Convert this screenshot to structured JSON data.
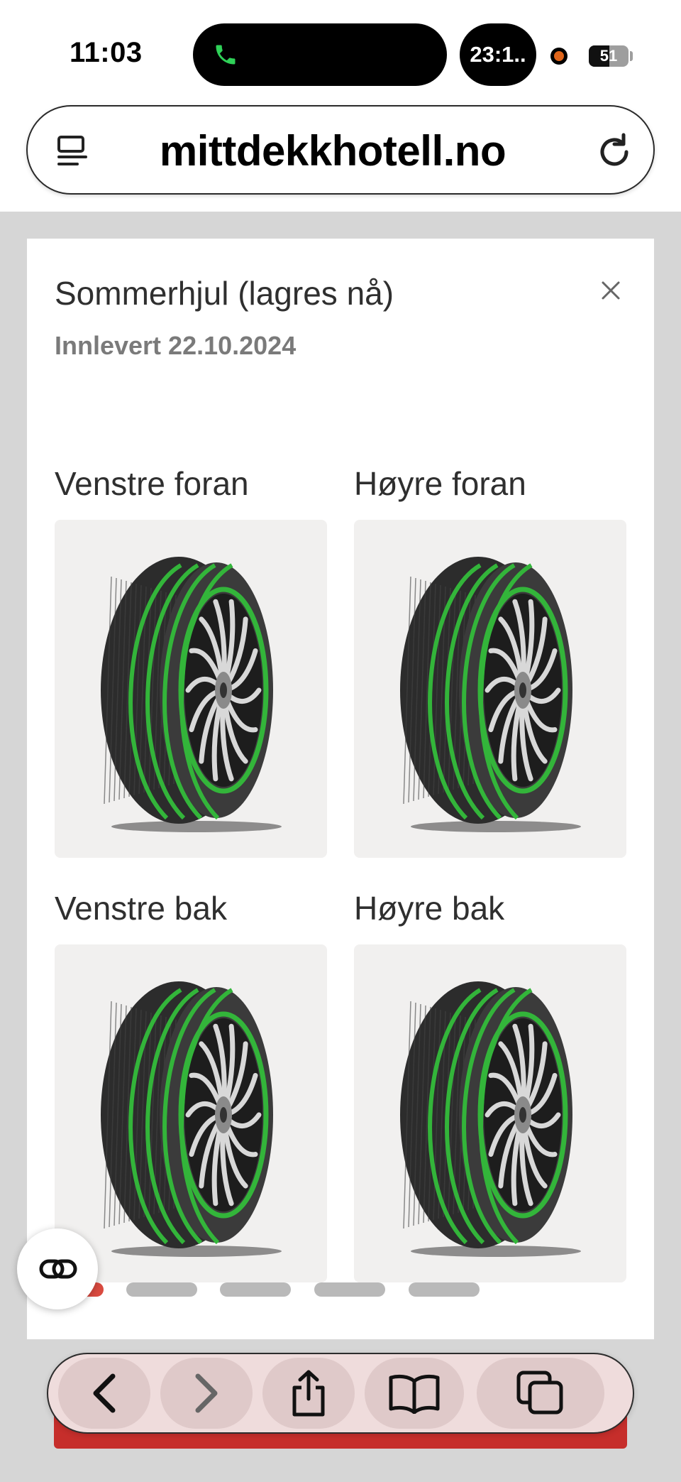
{
  "status_bar": {
    "time": "11:03",
    "call_timer": "23:1..",
    "battery_level": "51",
    "battery_fraction": 0.51,
    "call_icon_color": "#2fd158",
    "recording_dot_color": "#e0651a"
  },
  "browser": {
    "url": "mittdekkhotell.no",
    "tabs_icon": "page-menu-icon",
    "reload_icon": "reload-icon"
  },
  "card": {
    "title": "Sommerhjul (lagres nå)",
    "subtitle": "Innlevert 22.10.2024",
    "close_icon": "close-icon",
    "tires": [
      {
        "label": "Venstre foran",
        "tread_color": "#33b53a"
      },
      {
        "label": "Høyre foran",
        "tread_color": "#33b53a"
      },
      {
        "label": "Venstre bak",
        "tread_color": "#33b53a"
      },
      {
        "label": "Høyre bak",
        "tread_color": "#33b53a"
      }
    ],
    "pager": {
      "count": 5,
      "active_index": 0,
      "active_color": "#d94a3f",
      "inactive_color": "#b9b9b9"
    }
  },
  "toolbar": {
    "back_icon": "chevron-left-icon",
    "forward_icon": "chevron-right-icon",
    "share_icon": "share-icon",
    "bookmarks_icon": "book-icon",
    "tabs_icon": "tabs-icon"
  },
  "reader_icon": "link-icon",
  "accent": "#c62e2b"
}
